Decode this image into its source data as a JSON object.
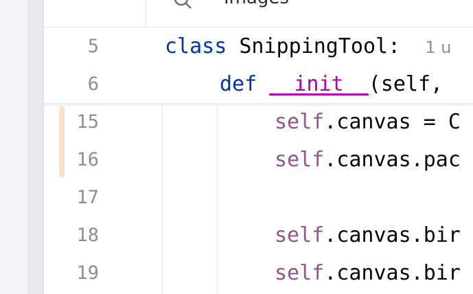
{
  "topbar": {
    "search_label": "Images"
  },
  "code": {
    "sticky_lines": [
      {
        "num": "5",
        "keyword": "class",
        "name": " SnippingTool:",
        "hint": "1 u"
      },
      {
        "num": "6",
        "keyword": "def",
        "dunder": "__init__",
        "rest": "(self,"
      }
    ],
    "lines": [
      {
        "num": "15",
        "self": "self",
        "rest": ".canvas = C"
      },
      {
        "num": "16",
        "self": "self",
        "rest": ".canvas.pac"
      },
      {
        "num": "17",
        "self": "",
        "rest": ""
      },
      {
        "num": "18",
        "self": "self",
        "rest": ".canvas.bir"
      },
      {
        "num": "19",
        "self": "self",
        "rest": ".canvas.bir"
      }
    ]
  }
}
